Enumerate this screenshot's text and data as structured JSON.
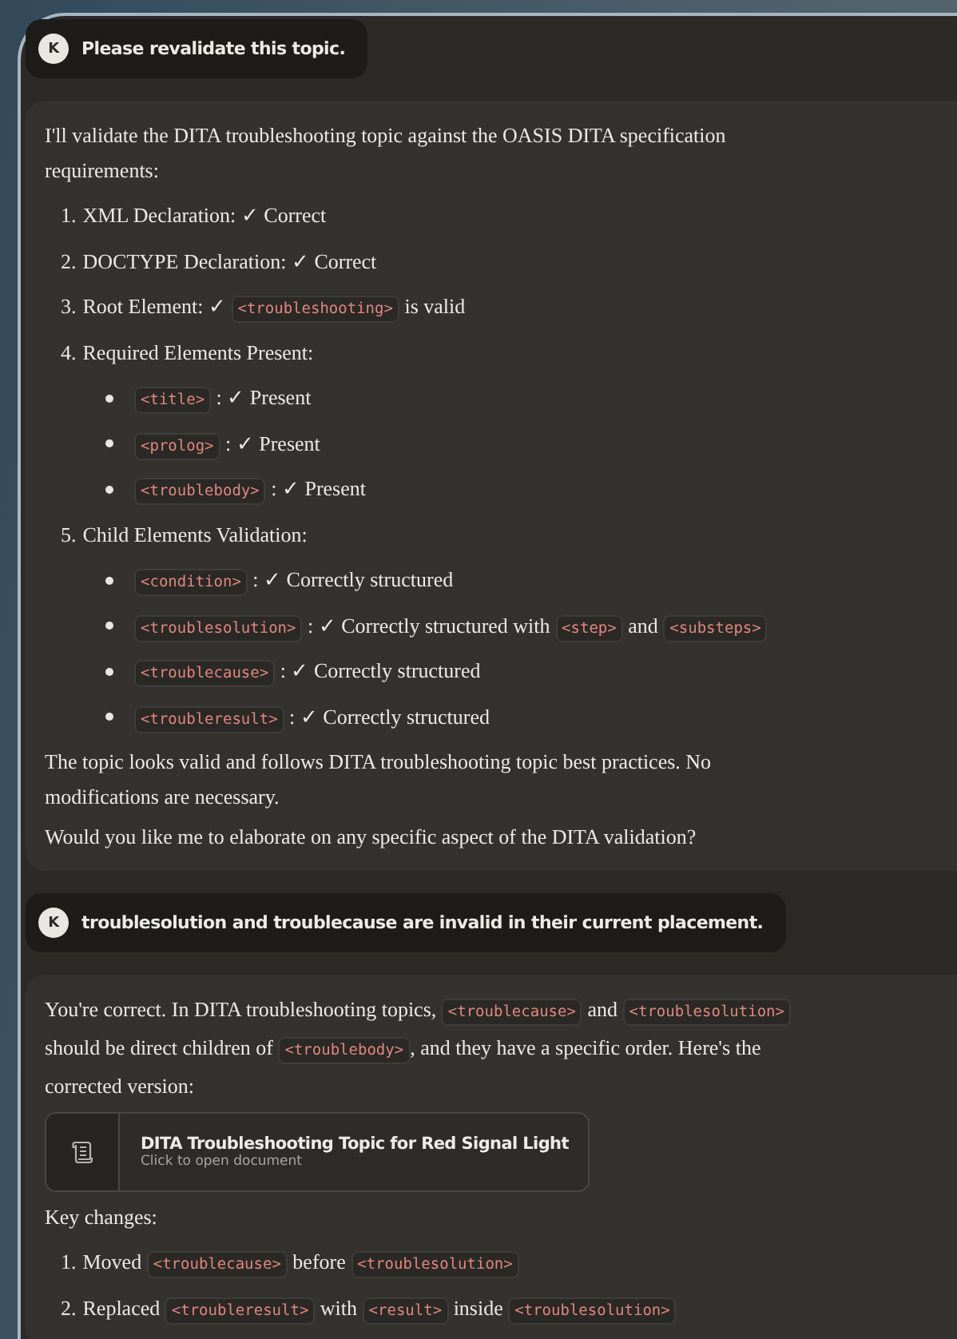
{
  "messages": [
    {
      "kind": "user",
      "avatar": "K",
      "text": "Please revalidate this topic."
    },
    {
      "kind": "assistant",
      "blocks": [
        {
          "kind": "paragraph",
          "segments": [
            {
              "kind": "text",
              "text": "I'll validate the DITA troubleshooting topic against the OASIS DITA specification requirements:"
            }
          ]
        },
        {
          "kind": "list",
          "items": [
            {
              "number": "1.",
              "segments": [
                {
                  "kind": "text",
                  "text": "XML Declaration: ✓ Correct"
                }
              ]
            },
            {
              "number": "2.",
              "segments": [
                {
                  "kind": "text",
                  "text": "DOCTYPE Declaration: ✓ Correct"
                }
              ]
            },
            {
              "number": "3.",
              "segments": [
                {
                  "kind": "text",
                  "text": "Root Element: ✓ "
                },
                {
                  "kind": "code",
                  "text": "<troubleshooting>"
                },
                {
                  "kind": "text",
                  "text": " is valid"
                }
              ]
            },
            {
              "number": "4.",
              "segments": [
                {
                  "kind": "text",
                  "text": "Required Elements Present:"
                }
              ],
              "children": [
                {
                  "segments": [
                    {
                      "kind": "code",
                      "text": "<title>"
                    },
                    {
                      "kind": "text",
                      "text": " : ✓ Present"
                    }
                  ]
                },
                {
                  "segments": [
                    {
                      "kind": "code",
                      "text": "<prolog>"
                    },
                    {
                      "kind": "text",
                      "text": " : ✓ Present"
                    }
                  ]
                },
                {
                  "segments": [
                    {
                      "kind": "code",
                      "text": "<troublebody>"
                    },
                    {
                      "kind": "text",
                      "text": " : ✓ Present"
                    }
                  ]
                }
              ]
            },
            {
              "number": "5.",
              "segments": [
                {
                  "kind": "text",
                  "text": "Child Elements Validation:"
                }
              ],
              "children": [
                {
                  "segments": [
                    {
                      "kind": "code",
                      "text": "<condition>"
                    },
                    {
                      "kind": "text",
                      "text": " : ✓ Correctly structured"
                    }
                  ]
                },
                {
                  "segments": [
                    {
                      "kind": "code",
                      "text": "<troublesolution>"
                    },
                    {
                      "kind": "text",
                      "text": " : ✓ Correctly structured with "
                    },
                    {
                      "kind": "code",
                      "text": "<step>"
                    },
                    {
                      "kind": "text",
                      "text": " and "
                    },
                    {
                      "kind": "code",
                      "text": "<substeps>"
                    }
                  ]
                },
                {
                  "segments": [
                    {
                      "kind": "code",
                      "text": "<troublecause>"
                    },
                    {
                      "kind": "text",
                      "text": " : ✓ Correctly structured"
                    }
                  ]
                },
                {
                  "segments": [
                    {
                      "kind": "code",
                      "text": "<troubleresult>"
                    },
                    {
                      "kind": "text",
                      "text": " : ✓ Correctly structured"
                    }
                  ]
                }
              ]
            }
          ]
        },
        {
          "kind": "paragraph",
          "segments": [
            {
              "kind": "text",
              "text": "The topic looks valid and follows DITA troubleshooting topic best practices. No modifications are necessary."
            }
          ]
        },
        {
          "kind": "paragraph",
          "segments": [
            {
              "kind": "text",
              "text": "Would you like me to elaborate on any specific aspect of the DITA validation?"
            }
          ]
        }
      ]
    },
    {
      "kind": "user",
      "avatar": "K",
      "text": "troublesolution and troublecause are invalid in their current placement."
    },
    {
      "kind": "assistant",
      "blocks": [
        {
          "kind": "paragraph",
          "segments": [
            {
              "kind": "text",
              "text": "You're correct. In DITA troubleshooting topics, "
            },
            {
              "kind": "code",
              "text": "<troublecause>"
            },
            {
              "kind": "text",
              "text": " and "
            },
            {
              "kind": "code",
              "text": "<troublesolution>"
            },
            {
              "kind": "text",
              "text": " should be direct children of "
            },
            {
              "kind": "code",
              "text": "<troublebody>"
            },
            {
              "kind": "text",
              "text": ", and they have a specific order. Here's the corrected version:"
            }
          ]
        },
        {
          "kind": "artifact",
          "title": "DITA Troubleshooting Topic for Red Signal Light",
          "subtitle": "Click to open document"
        },
        {
          "kind": "paragraph",
          "segments": [
            {
              "kind": "text",
              "text": "Key changes:"
            }
          ]
        },
        {
          "kind": "list",
          "items": [
            {
              "number": "1.",
              "segments": [
                {
                  "kind": "text",
                  "text": "Moved "
                },
                {
                  "kind": "code",
                  "text": "<troublecause>"
                },
                {
                  "kind": "text",
                  "text": " before "
                },
                {
                  "kind": "code",
                  "text": "<troublesolution>"
                }
              ]
            },
            {
              "number": "2.",
              "segments": [
                {
                  "kind": "text",
                  "text": "Replaced "
                },
                {
                  "kind": "code",
                  "text": "<troubleresult>"
                },
                {
                  "kind": "text",
                  "text": " with "
                },
                {
                  "kind": "code",
                  "text": "<result>"
                },
                {
                  "kind": "text",
                  "text": " inside "
                },
                {
                  "kind": "code",
                  "text": "<troublesolution>"
                }
              ]
            }
          ]
        }
      ]
    }
  ]
}
